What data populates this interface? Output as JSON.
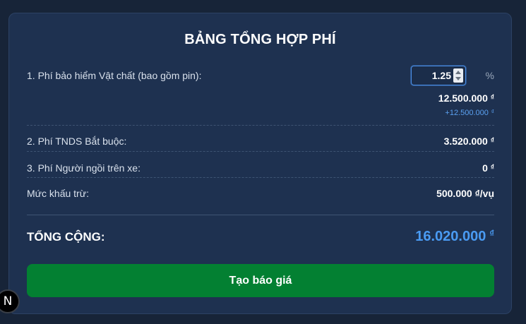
{
  "title": "BẢNG TỔNG HỢP PHÍ",
  "currency_symbol": "₫",
  "rows": {
    "vat_chat": {
      "label": "1. Phí bảo hiểm Vật chất (bao gồm pin):",
      "rate": "1.25",
      "rate_unit": "%",
      "amount": "12.500.000",
      "sub_amount": "+12.500.000"
    },
    "tnds": {
      "label": "2. Phí TNDS Bắt buộc:",
      "amount": "3.520.000"
    },
    "nguoi_ngoi": {
      "label": "3. Phí Người ngồi trên xe:",
      "amount": "0"
    },
    "khau_tru": {
      "label": "Mức khấu trừ:",
      "amount": "500.000",
      "unit": "₫/vụ"
    }
  },
  "total": {
    "label": "TỔNG CỘNG:",
    "amount": "16.020.000"
  },
  "create_quote_button": "Tạo báo giá",
  "badge_letter": "N",
  "colors": {
    "accent": "#4a9bf3",
    "button": "#038032",
    "background": "#172438",
    "card": "#1e3150"
  }
}
